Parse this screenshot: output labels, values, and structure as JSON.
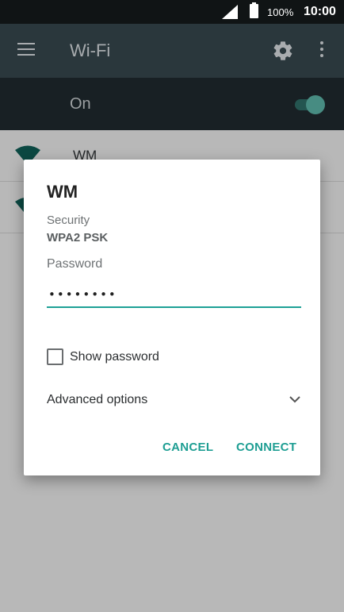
{
  "status_bar": {
    "battery_percent": "100%",
    "time": "10:00",
    "icons": [
      "signal-icon",
      "battery-icon"
    ]
  },
  "app_bar": {
    "title": "Wi-Fi",
    "icons": [
      "menu-icon",
      "gear-icon",
      "more-vert-icon"
    ]
  },
  "wifi_toggle": {
    "label": "On",
    "state": "on",
    "accent": "#5cb4a7"
  },
  "networks": [
    {
      "name": "WM"
    }
  ],
  "dialog": {
    "title": "WM",
    "security_label": "Security",
    "security_value": "WPA2 PSK",
    "password_label": "Password",
    "password_value": "12345678",
    "show_password_label": "Show password",
    "show_password_checked": false,
    "advanced_label": "Advanced options",
    "cancel_label": "CANCEL",
    "connect_label": "CONNECT",
    "accent": "#1e9e93"
  }
}
